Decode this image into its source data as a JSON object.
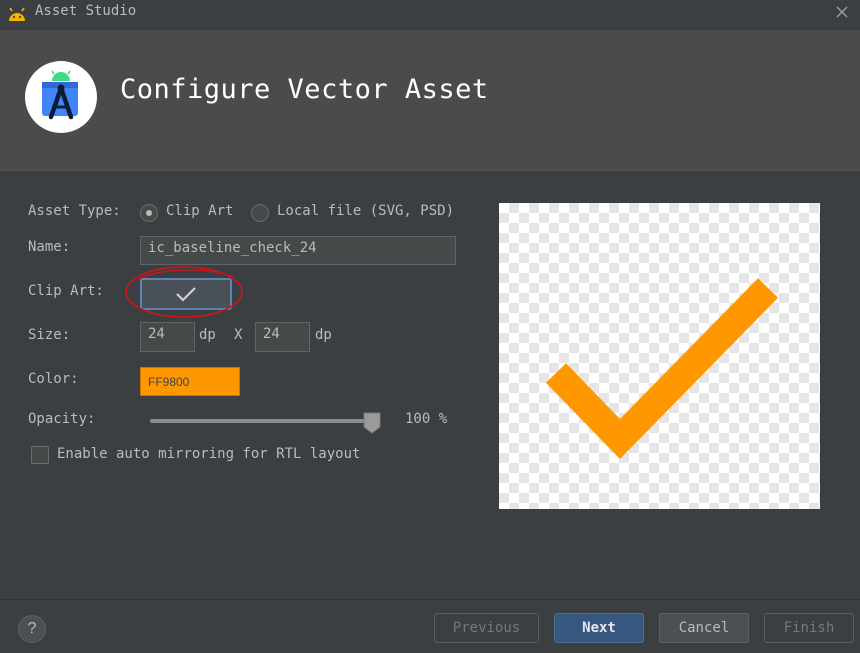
{
  "window": {
    "title": "Asset Studio"
  },
  "header": {
    "title": "Configure Vector Asset"
  },
  "form": {
    "asset_type": {
      "label": "Asset Type:",
      "options": [
        {
          "label": "Clip Art",
          "selected": true
        },
        {
          "label": "Local file (SVG, PSD)",
          "selected": false
        }
      ]
    },
    "name": {
      "label": "Name:",
      "value": "ic_baseline_check_24"
    },
    "clip_art": {
      "label": "Clip Art:",
      "icon": "check-icon"
    },
    "size": {
      "label": "Size:",
      "width": "24",
      "height": "24",
      "unit": "dp",
      "separator": "X"
    },
    "color": {
      "label": "Color:",
      "value": "FF9800",
      "hex": "#ff9800"
    },
    "opacity": {
      "label": "Opacity:",
      "value_text": "100 %",
      "value": 100
    },
    "auto_mirror": {
      "label": "Enable auto mirroring for RTL layout",
      "checked": false
    }
  },
  "preview": {
    "icon": "check-icon",
    "color": "#ff9800"
  },
  "footer": {
    "help": "?",
    "buttons": {
      "previous": "Previous",
      "next": "Next",
      "cancel": "Cancel",
      "finish": "Finish"
    }
  }
}
